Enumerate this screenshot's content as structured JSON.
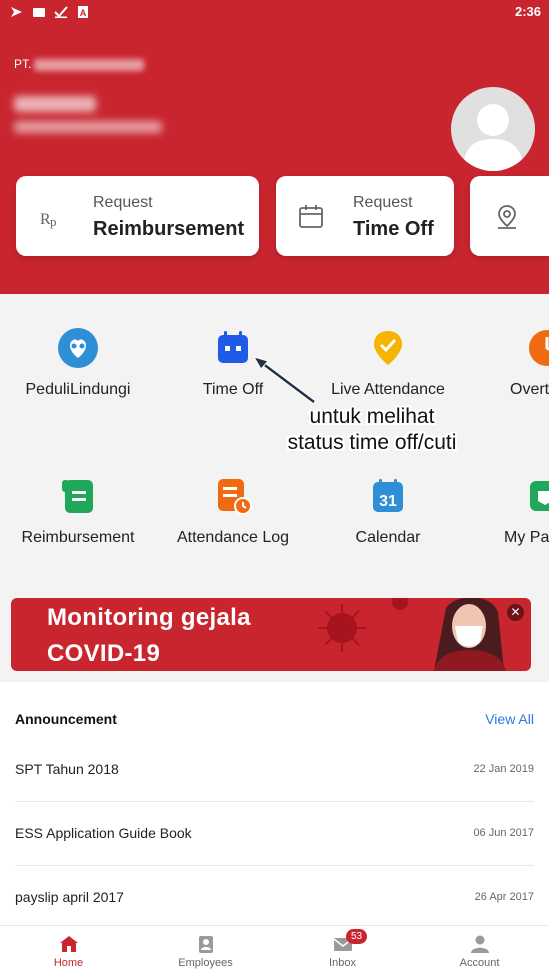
{
  "status_bar": {
    "time": "2:36"
  },
  "header": {
    "company_prefix": "PT."
  },
  "quick_actions": [
    {
      "small": "Request",
      "big": "Reimbursement",
      "icon": "rp-icon"
    },
    {
      "small": "Request",
      "big": "Time Off",
      "icon": "calendar-icon"
    },
    {
      "small": "",
      "big": "",
      "icon": "location-pin-icon"
    }
  ],
  "menu": {
    "row1": [
      {
        "label": "PeduliLindungi",
        "icon": "peduli-lindungi-icon",
        "color": "#2e8fd6"
      },
      {
        "label": "Time Off",
        "icon": "time-off-calendar-icon",
        "color": "#1f5be6"
      },
      {
        "label": "Live Attendance",
        "icon": "live-attendance-icon",
        "color": "#f5b400"
      },
      {
        "label": "Overt",
        "icon": "overtime-icon",
        "color": "#f06a12"
      }
    ],
    "row2": [
      {
        "label": "Reimbursement",
        "icon": "reimbursement-icon",
        "color": "#1fa85a"
      },
      {
        "label": "Attendance Log",
        "icon": "attendance-log-icon",
        "color": "#f06a12"
      },
      {
        "label": "Calendar",
        "icon": "calendar-31-icon",
        "color": "#2e8fd6",
        "day": "31"
      },
      {
        "label": "My Pa",
        "icon": "my-payslip-icon",
        "color": "#1fa85a"
      }
    ]
  },
  "annotation": {
    "line1": "untuk melihat",
    "line2": "status time off/cuti"
  },
  "banner": {
    "line1": "Monitoring gejala",
    "line2": "COVID-19"
  },
  "announcement": {
    "title": "Announcement",
    "view_all": "View All",
    "items": [
      {
        "name": "SPT Tahun 2018",
        "date": "22 Jan 2019"
      },
      {
        "name": "ESS Application Guide Book",
        "date": "06 Jun 2017"
      },
      {
        "name": "payslip april 2017",
        "date": "26 Apr 2017"
      }
    ]
  },
  "bottom_nav": {
    "items": [
      {
        "label": "Home",
        "icon": "home-icon"
      },
      {
        "label": "Employees",
        "icon": "employees-icon"
      },
      {
        "label": "Inbox",
        "icon": "inbox-icon"
      },
      {
        "label": "Account",
        "icon": "account-icon"
      }
    ],
    "inbox_badge": "53"
  },
  "colors": {
    "brand_red": "#c8252f",
    "link_blue": "#2a7be4",
    "menu_bg": "#f3f3f3"
  }
}
